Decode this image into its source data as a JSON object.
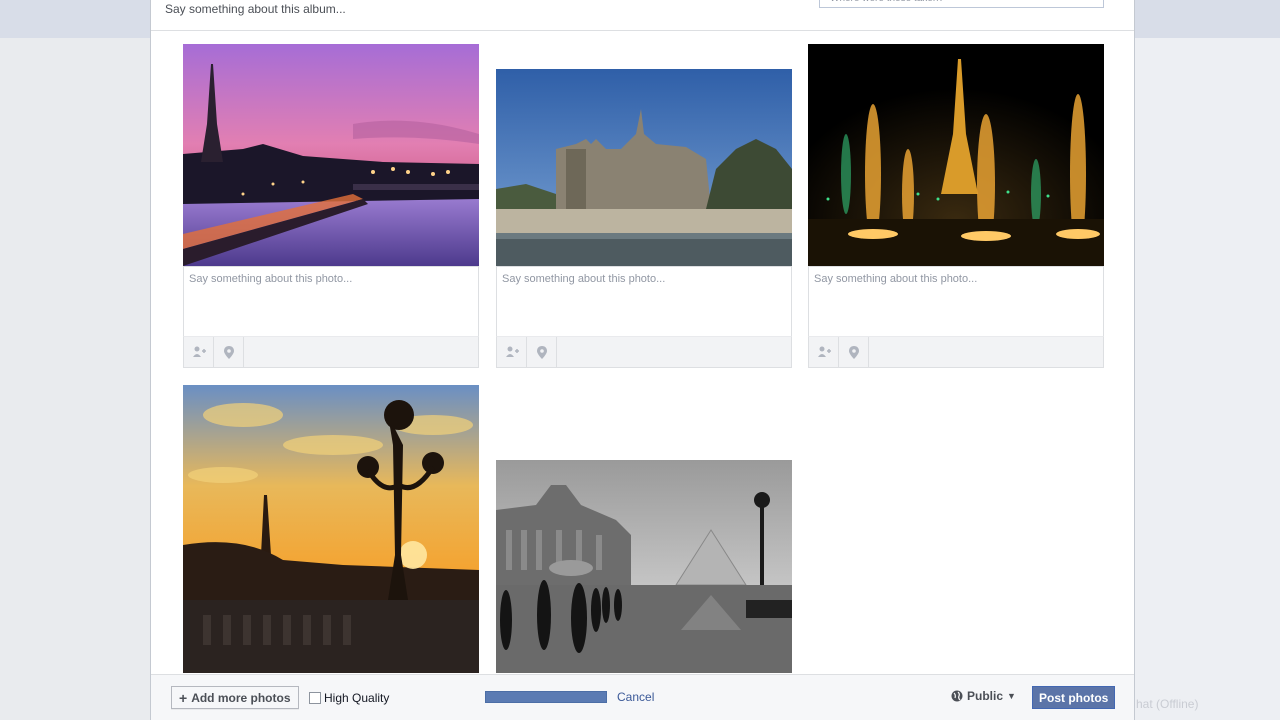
{
  "album": {
    "description_placeholder": "Say something about this album...",
    "location_placeholder": "Where were these taken?"
  },
  "photos": [
    {
      "caption_placeholder": "Say something about this photo...",
      "subject": "Paris riverside at dusk with Eiffel Tower"
    },
    {
      "caption_placeholder": "Say something about this photo...",
      "subject": "Notre-Dame cathedral by the Seine"
    },
    {
      "caption_placeholder": "Say something about this photo...",
      "subject": "Eiffel Tower with illuminated fountains at night"
    },
    {
      "caption_placeholder": "",
      "subject": "Ornate street lamp at sunset with Eiffel Tower"
    },
    {
      "caption_placeholder": "",
      "subject": "Louvre pyramid in black and white rain"
    }
  ],
  "tool_icons": {
    "tag": "tag-person-icon",
    "location": "map-pin-icon"
  },
  "footer": {
    "add_more_label": "Add more photos",
    "add_more_icon": "+",
    "high_quality_label": "High Quality",
    "upload_progress": 1.0,
    "cancel_label": "Cancel",
    "privacy_label": "Public",
    "post_label": "Post photos"
  },
  "background": {
    "chat_status": "hat (Offline)"
  },
  "colors": {
    "link": "#3b5998",
    "primary_button": "#5b74a8",
    "progress": "#5b7bb3"
  }
}
